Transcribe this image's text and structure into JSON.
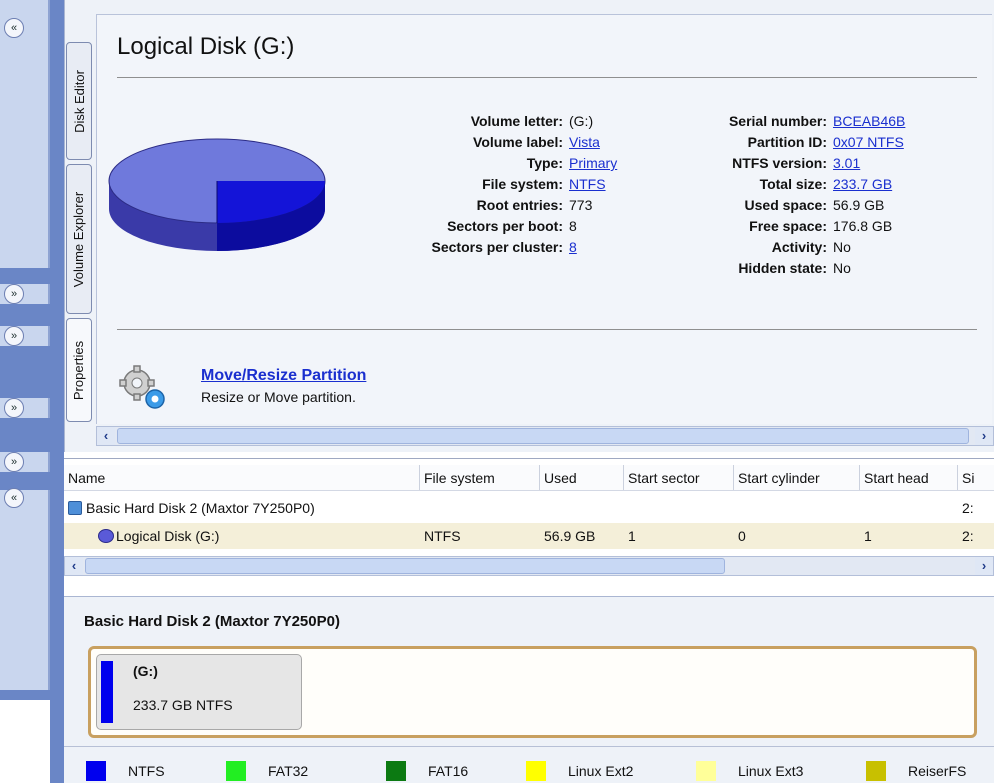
{
  "properties_panel": {
    "title": "Logical Disk (G:)",
    "tabs": [
      "Disk Editor",
      "Volume Explorer",
      "Properties"
    ],
    "left_props": [
      {
        "label": "Volume letter:",
        "value": "(G:)",
        "link": false
      },
      {
        "label": "Volume label:",
        "value": "Vista",
        "link": true
      },
      {
        "label": "Type:",
        "value": "Primary",
        "link": true
      },
      {
        "label": "File system:",
        "value": "NTFS",
        "link": true
      },
      {
        "label": "Root entries:",
        "value": "773",
        "link": false
      },
      {
        "label": "Sectors per boot:",
        "value": "8",
        "link": false
      },
      {
        "label": "Sectors per cluster:",
        "value": "8",
        "link": true
      }
    ],
    "right_props": [
      {
        "label": "Serial number:",
        "value": "BCEAB46B",
        "link": true
      },
      {
        "label": "Partition ID:",
        "value": "0x07 NTFS",
        "link": true
      },
      {
        "label": "NTFS version:",
        "value": "3.01",
        "link": true
      },
      {
        "label": "Total size:",
        "value": "233.7 GB",
        "link": true
      },
      {
        "label": "Used space:",
        "value": "56.9 GB",
        "link": false
      },
      {
        "label": "Free space:",
        "value": "176.8 GB",
        "link": false
      },
      {
        "label": "Activity:",
        "value": "No",
        "link": false
      },
      {
        "label": "Hidden state:",
        "value": "No",
        "link": false
      }
    ],
    "pie_used_fraction": 0.24,
    "action": {
      "title": "Move/Resize Partition",
      "description": "Resize or Move partition."
    }
  },
  "table": {
    "columns": [
      "Name",
      "File system",
      "Used",
      "Start sector",
      "Start cylinder",
      "Start head",
      "Si"
    ],
    "rows": [
      {
        "name": "Basic Hard Disk 2 (Maxtor 7Y250P0)",
        "fs": "",
        "used": "",
        "start_sector": "",
        "start_cylinder": "",
        "start_head": "",
        "size": "2:"
      },
      {
        "name": "Logical Disk (G:)",
        "fs": "NTFS",
        "used": "56.9 GB",
        "start_sector": "1",
        "start_cylinder": "0",
        "start_head": "1",
        "size": "2:"
      }
    ]
  },
  "disk_map": {
    "title": "Basic Hard Disk 2 (Maxtor 7Y250P0)",
    "partition_letter": "(G:)",
    "partition_info": "233.7 GB NTFS"
  },
  "legend": [
    {
      "label": "NTFS",
      "color": "#0000ee"
    },
    {
      "label": "FAT32",
      "color": "#22ee22"
    },
    {
      "label": "FAT16",
      "color": "#0c7a12"
    },
    {
      "label": "Linux Ext2",
      "color": "#ffff00"
    },
    {
      "label": "Linux Ext3",
      "color": "#ffff99"
    },
    {
      "label": "ReiserFS",
      "color": "#c8c000"
    }
  ]
}
